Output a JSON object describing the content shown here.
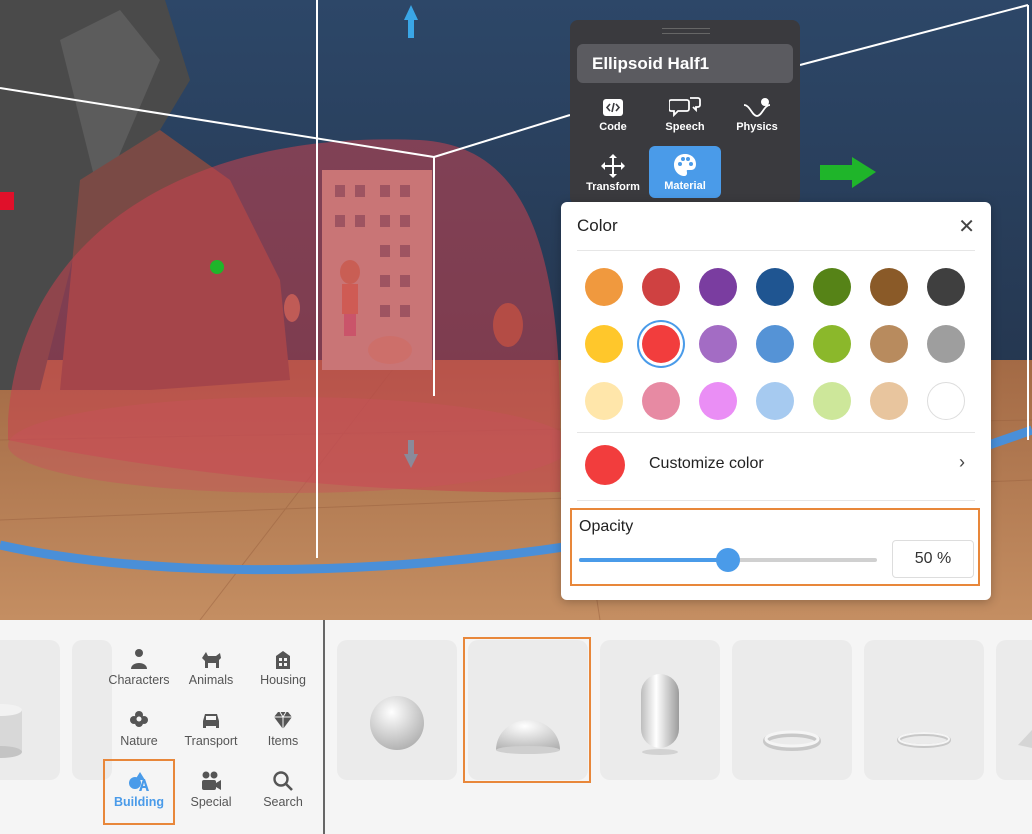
{
  "object": {
    "name": "Ellipsoid Half1"
  },
  "tools": [
    {
      "id": "code",
      "label": "Code",
      "icon": "code-icon"
    },
    {
      "id": "speech",
      "label": "Speech",
      "icon": "speech-icon"
    },
    {
      "id": "physics",
      "label": "Physics",
      "icon": "physics-icon"
    },
    {
      "id": "transform",
      "label": "Transform",
      "icon": "move-icon"
    },
    {
      "id": "material",
      "label": "Material",
      "icon": "palette-icon",
      "active": true
    }
  ],
  "color_panel": {
    "title": "Color",
    "close_icon": "close-icon",
    "swatches": [
      [
        "#f0993e",
        "#cf4141",
        "#7a3da0",
        "#1f5591",
        "#568317",
        "#8a5a28",
        "#3f3f3f"
      ],
      [
        "#ffc72b",
        "#f23d3d",
        "#a36cc4",
        "#5593d6",
        "#8bb82b",
        "#b88b5e",
        "#9e9e9e"
      ],
      [
        "#ffe6aa",
        "#e78aa3",
        "#ea8ef5",
        "#a6caf0",
        "#cde79a",
        "#e8c59e",
        "#ffffff"
      ]
    ],
    "selected_color": "#f23d3d",
    "customize_label": "Customize color",
    "customize_chevron": "chevron-right-icon",
    "opacity_label": "Opacity",
    "opacity_value": 50,
    "opacity_text": "50 %"
  },
  "categories": [
    {
      "id": "characters",
      "label": "Characters",
      "icon": "person-icon"
    },
    {
      "id": "animals",
      "label": "Animals",
      "icon": "dog-icon"
    },
    {
      "id": "housing",
      "label": "Housing",
      "icon": "building-icon"
    },
    {
      "id": "nature",
      "label": "Nature",
      "icon": "flower-icon"
    },
    {
      "id": "transport",
      "label": "Transport",
      "icon": "car-icon"
    },
    {
      "id": "items",
      "label": "Items",
      "icon": "diamond-icon"
    },
    {
      "id": "building",
      "label": "Building",
      "icon": "shapes-icon",
      "active": true
    },
    {
      "id": "special",
      "label": "Special",
      "icon": "camera-icon"
    },
    {
      "id": "search",
      "label": "Search",
      "icon": "search-icon"
    }
  ],
  "shapes": [
    {
      "id": "cylinder",
      "icon": "cylinder-icon"
    },
    {
      "id": "sphere",
      "icon": "sphere-icon"
    },
    {
      "id": "half-sphere",
      "icon": "half-sphere-icon",
      "selected": true
    },
    {
      "id": "capsule",
      "icon": "capsule-icon"
    },
    {
      "id": "torus",
      "icon": "torus-icon"
    },
    {
      "id": "thin-torus",
      "icon": "thin-torus-icon"
    }
  ]
}
